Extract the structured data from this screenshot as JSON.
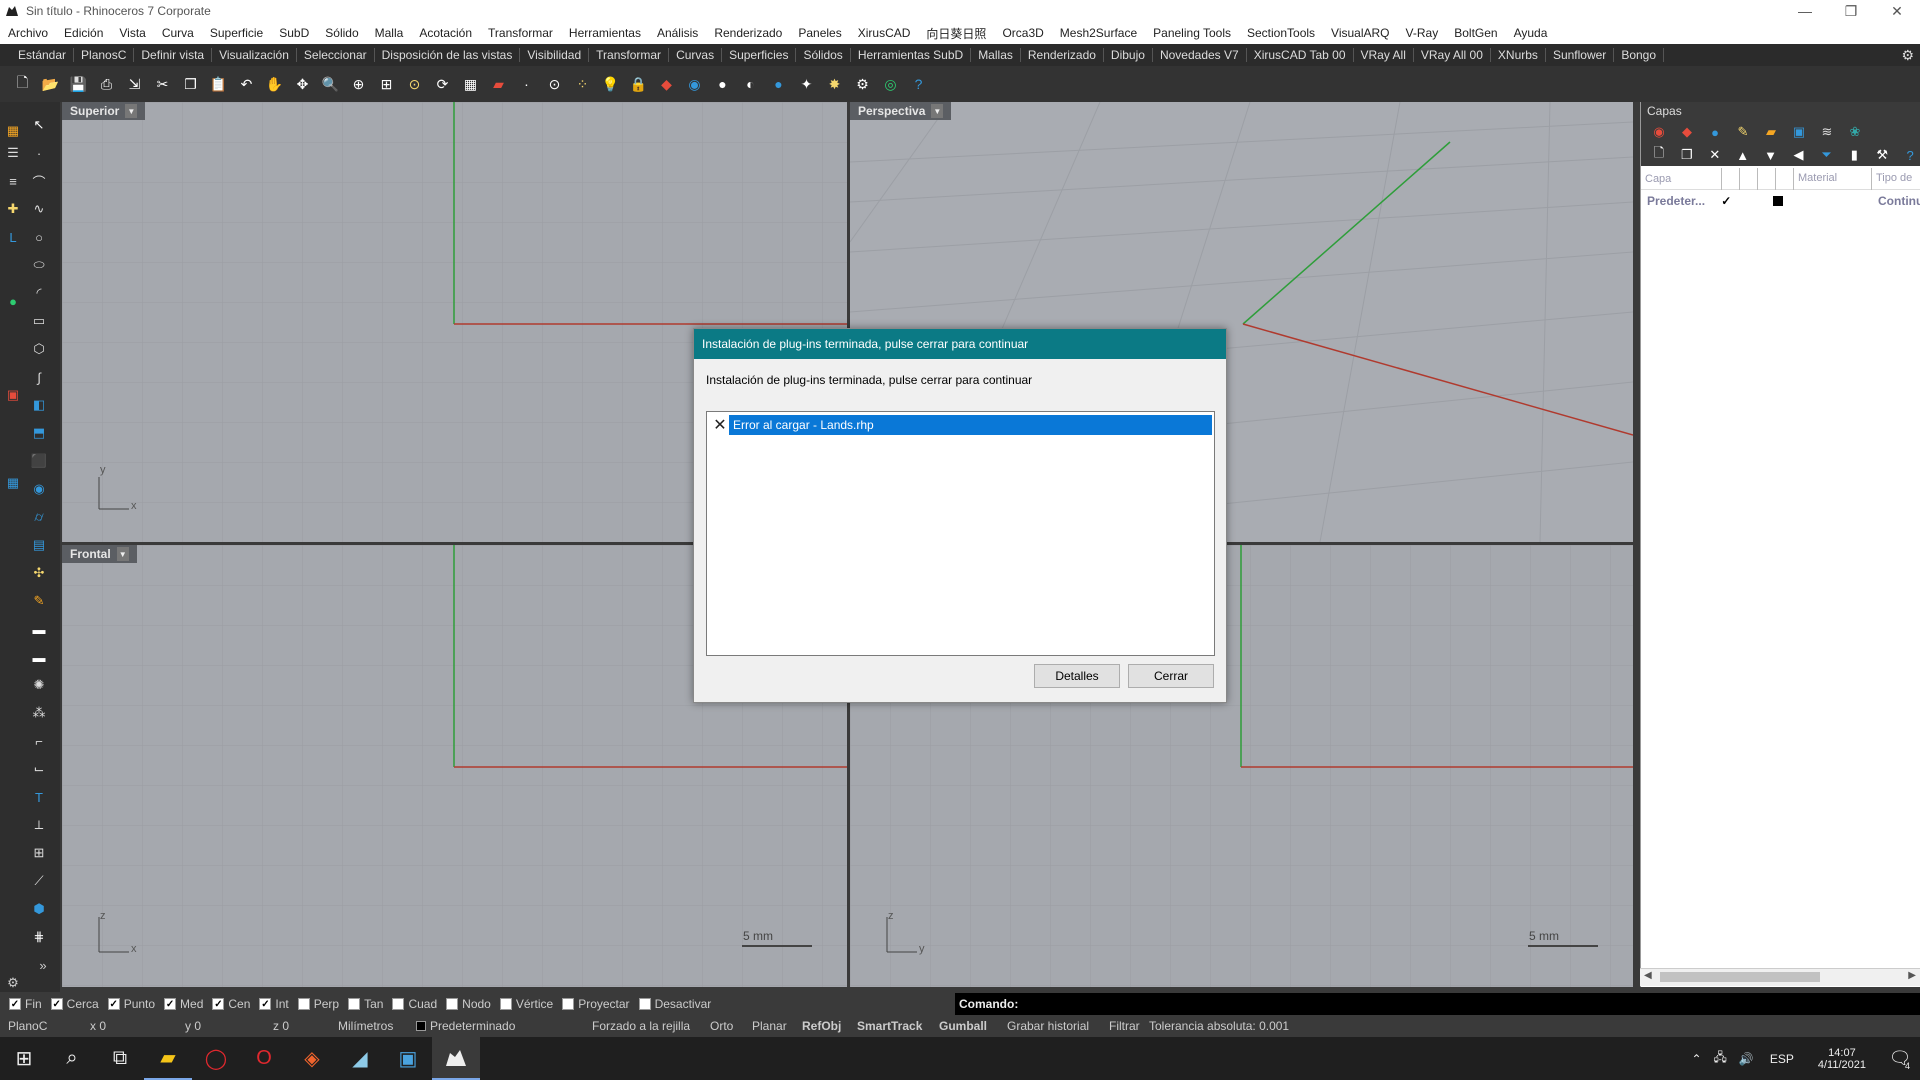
{
  "window": {
    "title": "Sin título - Rhinoceros 7 Corporate",
    "minimize": "—",
    "restore": "❐",
    "close": "✕"
  },
  "menu": [
    "Archivo",
    "Edición",
    "Vista",
    "Curva",
    "Superficie",
    "SubD",
    "Sólido",
    "Malla",
    "Acotación",
    "Transformar",
    "Herramientas",
    "Análisis",
    "Renderizado",
    "Paneles",
    "XirusCAD",
    "向日葵日照",
    "Orca3D",
    "Mesh2Surface",
    "Paneling Tools",
    "SectionTools",
    "VisualARQ",
    "V-Ray",
    "BoltGen",
    "Ayuda"
  ],
  "tabs": [
    "Estándar",
    "PlanosC",
    "Definir vista",
    "Visualización",
    "Seleccionar",
    "Disposición de las vistas",
    "Visibilidad",
    "Transformar",
    "Curvas",
    "Superficies",
    "Sólidos",
    "Herramientas SubD",
    "Mallas",
    "Renderizado",
    "Dibujo",
    "Novedades V7",
    "XirusCAD Tab 00",
    "VRay All",
    "VRay All 00",
    "XNurbs",
    "Sunflower",
    "Bongo"
  ],
  "viewports": {
    "superior": {
      "label": "Superior",
      "axis_a": "y",
      "axis_b": "x"
    },
    "perspectiva": {
      "label": "Perspectiva"
    },
    "frontal": {
      "label": "Frontal",
      "axis_a": "z",
      "axis_b": "x",
      "scale": "5 mm"
    },
    "derecha": {
      "axis_a": "z",
      "axis_b": "y",
      "scale": "5 mm"
    }
  },
  "layers_panel": {
    "title": "Capas",
    "columns": [
      "Capa",
      "Material",
      "Tipo de"
    ],
    "rows": [
      {
        "name": "Predeter...",
        "check": "✓",
        "linetype": "Continu"
      }
    ]
  },
  "osnaps": [
    {
      "label": "Fin",
      "checked": true
    },
    {
      "label": "Cerca",
      "checked": true
    },
    {
      "label": "Punto",
      "checked": true
    },
    {
      "label": "Med",
      "checked": true
    },
    {
      "label": "Cen",
      "checked": true
    },
    {
      "label": "Int",
      "checked": true
    },
    {
      "label": "Perp",
      "checked": false
    },
    {
      "label": "Tan",
      "checked": false
    },
    {
      "label": "Cuad",
      "checked": false
    },
    {
      "label": "Nodo",
      "checked": false
    },
    {
      "label": "Vértice",
      "checked": false
    },
    {
      "label": "Proyectar",
      "checked": false
    },
    {
      "label": "Desactivar",
      "checked": false
    }
  ],
  "command": {
    "label": "Comando:"
  },
  "status": {
    "cplane": "PlanoC",
    "x": "x 0",
    "y": "y 0",
    "z": "z 0",
    "units": "Milímetros",
    "layer": "Predeterminado",
    "grid_snap": "Forzado a la rejilla",
    "ortho": "Orto",
    "planar": "Planar",
    "refobj": "RefObj",
    "smarttrack": "SmartTrack",
    "gumball": "Gumball",
    "history": "Grabar historial",
    "filter": "Filtrar",
    "tolerance": "Tolerancia absoluta: 0.001"
  },
  "dialog": {
    "title": "Instalación de plug-ins terminada, pulse cerrar para continuar",
    "message": "Instalación de plug-ins terminada, pulse cerrar para continuar",
    "items": [
      {
        "icon": "error-x-icon",
        "text": "Error al cargar - Lands.rhp"
      }
    ],
    "details_button": "Detalles",
    "close_button": "Cerrar"
  },
  "taskbar": {
    "lang": "ESP",
    "time": "14:07",
    "date": "4/11/2021",
    "notifications": "4"
  },
  "colors": {
    "viewport_bg": "#a5a8ae",
    "grid": "#9c9fa5",
    "x_axis": "#b03a2e",
    "y_axis": "#2e9e3a",
    "dialog_title": "#0b7a85",
    "selection": "#0a78d7"
  }
}
